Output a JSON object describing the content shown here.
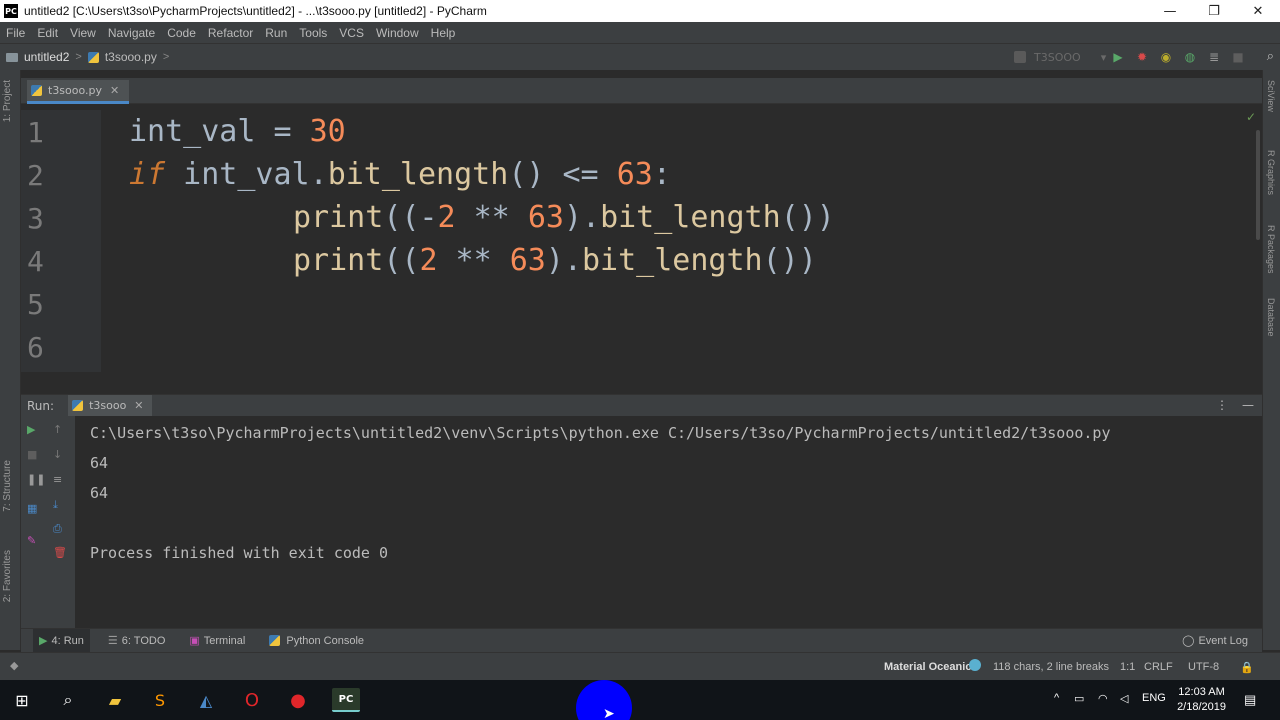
{
  "window": {
    "title": "untitled2 [C:\\Users\\t3so\\PycharmProjects\\untitled2] - ...\\t3sooo.py [untitled2] - PyCharm",
    "logo_text": "PC"
  },
  "menu": [
    "File",
    "Edit",
    "View",
    "Navigate",
    "Code",
    "Refactor",
    "Run",
    "Tools",
    "VCS",
    "Window",
    "Help"
  ],
  "navbar": {
    "project": "untitled2",
    "file": "t3sooo.py",
    "run_config": "T3SOOO"
  },
  "left_strip": {
    "project": "1: Project",
    "structure": "7: Structure",
    "favorites": "2: Favorites"
  },
  "right_strip": {
    "sciview": "SciView",
    "r_graphics": "R Graphics",
    "r_packages": "R Packages",
    "database": "Database"
  },
  "editor": {
    "tab_label": "t3sooo.py",
    "line_numbers": [
      "1",
      "2",
      "3",
      "4",
      "5",
      "6"
    ],
    "lines": {
      "l1_var": "int_val",
      "l1_op": " = ",
      "l1_num": "30",
      "l2_kw": "if",
      "l2_a": " int_val.",
      "l2_fn": "bit_length",
      "l2_b": "() <= ",
      "l2_num": "63",
      "l2_c": ":",
      "l3_fn": "print",
      "l3_a": "((-",
      "l3_n1": "2",
      "l3_b": " ** ",
      "l3_n2": "63",
      "l3_c": ").",
      "l3_fn2": "bit_length",
      "l3_d": "())",
      "l4_fn": "print",
      "l4_a": "((",
      "l4_n1": "2",
      "l4_b": " ** ",
      "l4_n2": "63",
      "l4_c": ").",
      "l4_fn2": "bit_length",
      "l4_d": "())"
    }
  },
  "run_panel": {
    "label": "Run:",
    "tab_label": "t3sooo",
    "output": [
      "C:\\Users\\t3so\\PycharmProjects\\untitled2\\venv\\Scripts\\python.exe C:/Users/t3so/PycharmProjects/untitled2/t3sooo.py",
      "64",
      "64",
      "",
      "Process finished with exit code 0"
    ]
  },
  "bottom_tabs": {
    "run": "4: Run",
    "todo": "6: TODO",
    "terminal": "Terminal",
    "python_console": "Python Console",
    "event_log": "Event Log"
  },
  "status": {
    "theme": "Material Oceanic",
    "chars": "118 chars, 2 line breaks",
    "position": "1:1",
    "line_sep": "CRLF",
    "encoding": "UTF-8"
  },
  "taskbar": {
    "language": "ENG",
    "time": "12:03 AM",
    "date": "2/18/2019"
  },
  "colors": {
    "keyword": "#cc7832",
    "number": "#f58b59",
    "function": "#dcc8a0",
    "text": "#a9b7c6",
    "accent": "#4a88c7"
  }
}
